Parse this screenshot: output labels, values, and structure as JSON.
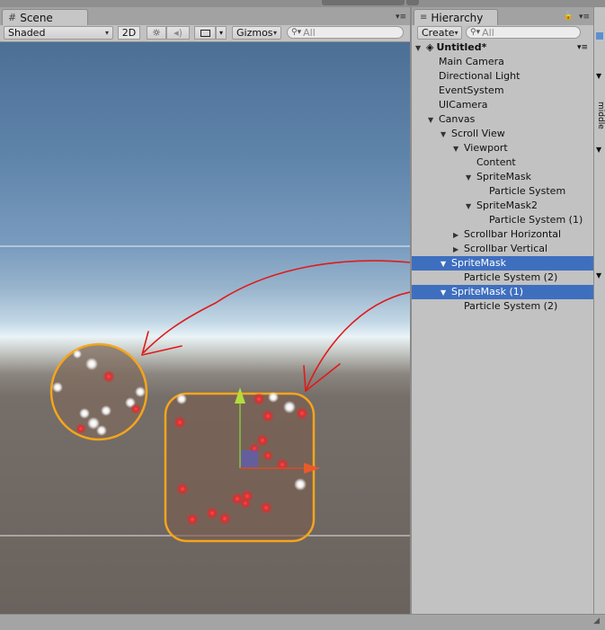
{
  "scene": {
    "tab_label": "Scene",
    "shading_mode": "Shaded",
    "mode_2d": "2D",
    "gizmos_label": "Gizmos",
    "search_placeholder": "All"
  },
  "hierarchy": {
    "tab_label": "Hierarchy",
    "create_label": "Create",
    "search_placeholder": "All",
    "items": [
      {
        "label": "Untitled*",
        "depth": 0,
        "fold": "open",
        "selected": false,
        "scene": true
      },
      {
        "label": "Main Camera",
        "depth": 1,
        "fold": "none",
        "selected": false
      },
      {
        "label": "Directional Light",
        "depth": 1,
        "fold": "none",
        "selected": false
      },
      {
        "label": "EventSystem",
        "depth": 1,
        "fold": "none",
        "selected": false
      },
      {
        "label": "UICamera",
        "depth": 1,
        "fold": "none",
        "selected": false
      },
      {
        "label": "Canvas",
        "depth": 1,
        "fold": "open",
        "selected": false
      },
      {
        "label": "Scroll View",
        "depth": 2,
        "fold": "open",
        "selected": false
      },
      {
        "label": "Viewport",
        "depth": 3,
        "fold": "open",
        "selected": false
      },
      {
        "label": "Content",
        "depth": 4,
        "fold": "none",
        "selected": false
      },
      {
        "label": "SpriteMask",
        "depth": 4,
        "fold": "open",
        "selected": false
      },
      {
        "label": "Particle System",
        "depth": 5,
        "fold": "none",
        "selected": false
      },
      {
        "label": "SpriteMask2",
        "depth": 4,
        "fold": "open",
        "selected": false
      },
      {
        "label": "Particle System (1)",
        "depth": 5,
        "fold": "none",
        "selected": false
      },
      {
        "label": "Scrollbar Horizontal",
        "depth": 3,
        "fold": "closed",
        "selected": false
      },
      {
        "label": "Scrollbar Vertical",
        "depth": 3,
        "fold": "closed",
        "selected": false
      },
      {
        "label": "SpriteMask",
        "depth": 2,
        "fold": "open",
        "selected": true
      },
      {
        "label": "Particle System (2)",
        "depth": 3,
        "fold": "none",
        "selected": false
      },
      {
        "label": "SpriteMask (1)",
        "depth": 2,
        "fold": "open",
        "selected": true
      },
      {
        "label": "Particle System (2)",
        "depth": 3,
        "fold": "none",
        "selected": false
      }
    ]
  },
  "inspector": {
    "partial_label": "middle"
  },
  "icons": {
    "scene_tab": "grid-icon",
    "hierarchy_tab": "list-icon",
    "sun": "light-toggle-icon",
    "audio": "audio-toggle-icon",
    "image": "effects-toggle-icon",
    "lock": "lock-icon",
    "menu": "panel-menu-icon"
  },
  "colors": {
    "selection": "#3e6fbf",
    "mask_outline": "#f4a51c",
    "annotation": "#e01a1a",
    "particle_red": "#e03030"
  }
}
